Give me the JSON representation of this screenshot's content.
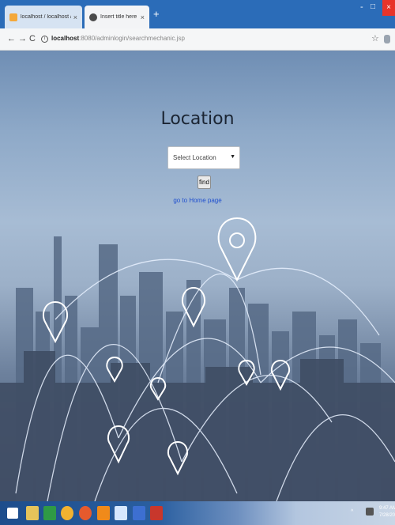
{
  "browser": {
    "tabs": [
      {
        "title": "localhost / localhost / phpMyAd"
      },
      {
        "title": "Insert title here"
      }
    ],
    "new_tab_label": "+",
    "window_controls": {
      "minimize": "-",
      "maximize": "□",
      "close": "×"
    },
    "url_host": "localhost",
    "url_path": ":8080/adminlogin/searchmechanic.jsp"
  },
  "page": {
    "heading": "Location",
    "select_value": "Select Location",
    "find_label": "find",
    "home_link": "go to Home page"
  },
  "taskbar": {
    "icons": [
      "windows-start",
      "file-explorer",
      "spreadsheet-app",
      "chrome",
      "firefox",
      "sublime-text",
      "vpn-app",
      "database-app",
      "java-app"
    ],
    "tray_text": "^",
    "clock_time": "9:47 AM",
    "clock_date": "7/28/2019"
  },
  "colors": {
    "tab_bar": "#2b6cb8",
    "close_button": "#e8342a",
    "link": "#1f4fcf"
  }
}
